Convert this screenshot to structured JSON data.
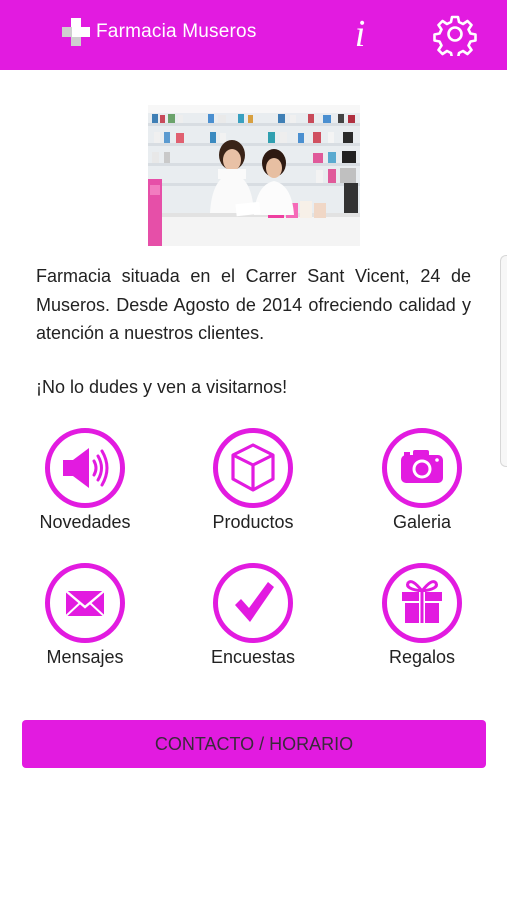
{
  "header": {
    "title": "Farmacia Museros",
    "info_label": "i",
    "logo_icon": "pharmacy-cross-logo",
    "settings_icon": "gear-icon"
  },
  "intro": {
    "description": "Farmacia situada en el Carrer Sant Vicent, 24 de Museros. Desde Agosto de 2014 ofreciendo calidad y atención a nuestros clientes.",
    "tagline": "¡No lo dudes y ven a visitarnos!"
  },
  "menu": {
    "items": [
      {
        "label": "Novedades",
        "icon": "megaphone-icon"
      },
      {
        "label": "Productos",
        "icon": "box-icon"
      },
      {
        "label": "Galeria",
        "icon": "camera-icon"
      },
      {
        "label": "Mensajes",
        "icon": "envelope-icon"
      },
      {
        "label": "Encuestas",
        "icon": "checkmark-icon"
      },
      {
        "label": "Regalos",
        "icon": "gift-icon"
      }
    ]
  },
  "contact": {
    "label": "CONTACTO / HORARIO"
  },
  "colors": {
    "accent": "#e21be0",
    "background": "#ffffff",
    "text": "#222222"
  }
}
